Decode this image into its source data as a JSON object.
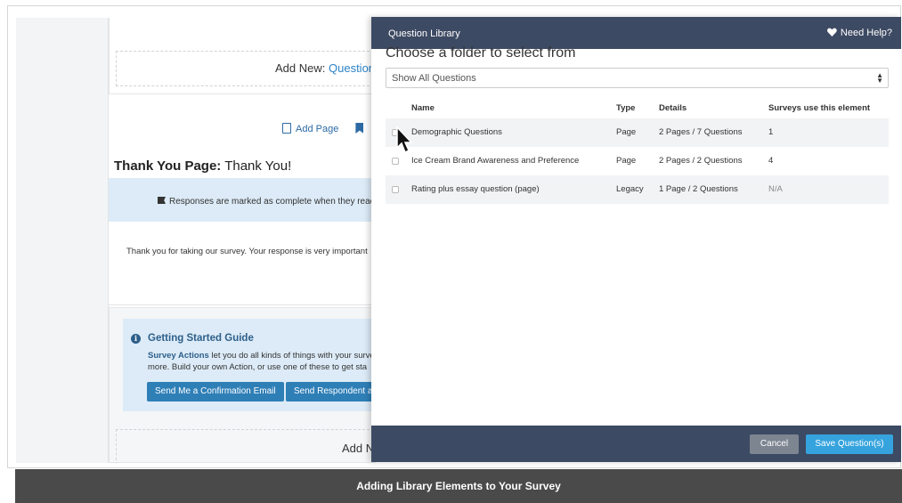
{
  "builder": {
    "addnew_label": "Add New:",
    "addnew_link": "Question",
    "addpage_label": "Add Page",
    "ty_title_bold": "Thank You Page:",
    "ty_title_rest": " Thank You!",
    "responses_text": "Responses are marked as complete when they reach",
    "thanks_text": "Thank you for taking our survey. Your response is very important",
    "guide_title": "Getting Started Guide",
    "guide_bold": "Survey Actions",
    "guide_text_1": " let you do all kinds of things with your surve",
    "guide_text_2": "more. Build your own Action, or use one of these to get sta",
    "btn_confirm": "Send Me a Confirmation Email",
    "btn_respondent": "Send Respondent a C",
    "addnew2_label": "Add N"
  },
  "modal": {
    "title": "Question Library",
    "help": "Need Help?",
    "choose": "Choose a folder to select from",
    "select_value": "Show All Questions",
    "columns": [
      "Name",
      "Type",
      "Details",
      "Surveys use this element"
    ],
    "rows": [
      {
        "name": "Demographic Questions",
        "type": "Page",
        "details": "2 Pages / 7 Questions",
        "surveys": "1"
      },
      {
        "name": "Ice Cream Brand Awareness and Preference",
        "type": "Page",
        "details": "2 Pages / 2 Questions",
        "surveys": "4"
      },
      {
        "name": "Rating plus essay question (page)",
        "type": "Legacy",
        "details": "1 Page / 2 Questions",
        "surveys": "N/A"
      }
    ],
    "cancel": "Cancel",
    "save": "Save Question(s)"
  },
  "caption": "Adding Library Elements to Your Survey"
}
